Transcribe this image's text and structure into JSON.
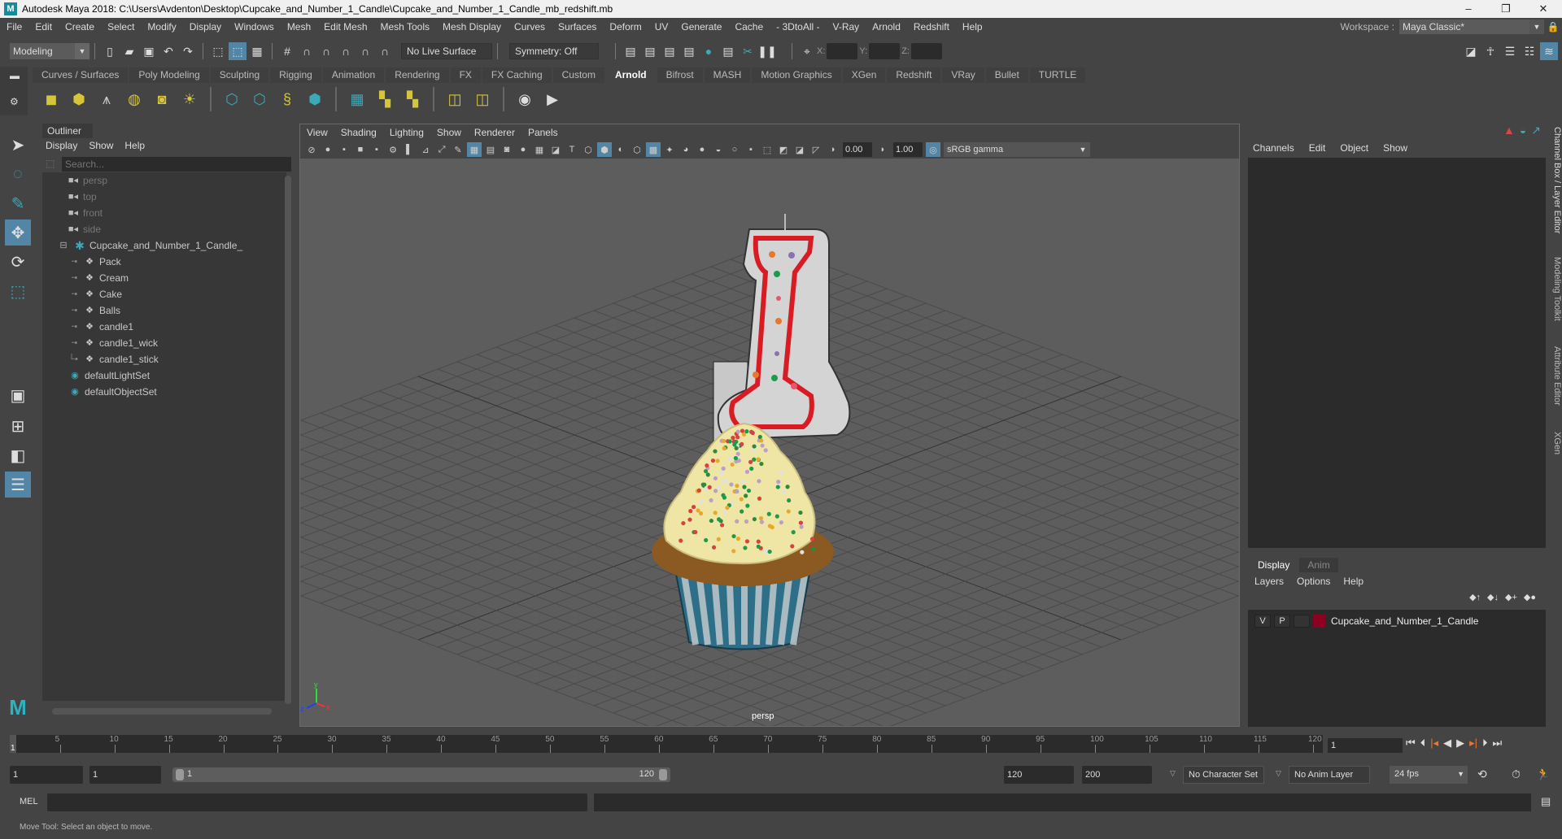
{
  "window": {
    "title": "Autodesk Maya 2018: C:\\Users\\Avdenton\\Desktop\\Cupcake_and_Number_1_Candle\\Cupcake_and_Number_1_Candle_mb_redshift.mb",
    "logo": "M",
    "minimize": "–",
    "maximize": "❐",
    "close": "✕"
  },
  "menubar": {
    "items": [
      "File",
      "Edit",
      "Create",
      "Select",
      "Modify",
      "Display",
      "Windows",
      "Mesh",
      "Edit Mesh",
      "Mesh Tools",
      "Mesh Display",
      "Curves",
      "Surfaces",
      "Deform",
      "UV",
      "Generate",
      "Cache",
      "- 3DtoAll -",
      "V-Ray",
      "Arnold",
      "Redshift",
      "Help"
    ],
    "workspace_label": "Workspace :",
    "workspace_value": "Maya Classic*"
  },
  "statusline": {
    "mode": "Modeling",
    "live_surface": "No Live Surface",
    "symmetry": "Symmetry: Off",
    "x_label": "X:",
    "y_label": "Y:",
    "z_label": "Z:"
  },
  "shelf": {
    "tabs": [
      "Curves / Surfaces",
      "Poly Modeling",
      "Sculpting",
      "Rigging",
      "Animation",
      "Rendering",
      "FX",
      "FX Caching",
      "Custom",
      "Arnold",
      "Bifrost",
      "MASH",
      "Motion Graphics",
      "XGen",
      "Redshift",
      "VRay",
      "Bullet",
      "TURTLE"
    ],
    "active_tab": "Arnold"
  },
  "outliner": {
    "title": "Outliner",
    "menu": [
      "Display",
      "Show",
      "Help"
    ],
    "search_placeholder": "Search...",
    "cameras": [
      "persp",
      "top",
      "front",
      "side"
    ],
    "group": "Cupcake_and_Number_1_Candle_",
    "children": [
      "Pack",
      "Cream",
      "Cake",
      "Balls",
      "candle1",
      "candle1_wick",
      "candle1_stick"
    ],
    "sets": [
      "defaultLightSet",
      "defaultObjectSet"
    ]
  },
  "viewport": {
    "menu": [
      "View",
      "Shading",
      "Lighting",
      "Show",
      "Renderer",
      "Panels"
    ],
    "exposure": "0.00",
    "gamma_value": "1.00",
    "color_space": "sRGB gamma",
    "camera_label": "persp",
    "axis": {
      "x": "x",
      "y": "y",
      "z": "z"
    }
  },
  "channelbox": {
    "menu": [
      "Channels",
      "Edit",
      "Object",
      "Show"
    ],
    "layer_tabs": [
      "Display",
      "Anim"
    ],
    "active_layer_tab": "Display",
    "layer_menu": [
      "Layers",
      "Options",
      "Help"
    ],
    "layer": {
      "v": "V",
      "p": "P",
      "name": "Cupcake_and_Number_1_Candle",
      "color": "#8c0020"
    }
  },
  "side_tabs": [
    "Channel Box / Layer Editor",
    "Modeling Toolkit",
    "Attribute Editor",
    "XGen"
  ],
  "timeline": {
    "ticks": [
      5,
      10,
      15,
      20,
      25,
      30,
      35,
      40,
      45,
      50,
      55,
      60,
      65,
      70,
      75,
      80,
      85,
      90,
      95,
      100,
      105,
      110,
      115,
      120
    ],
    "range_min": 1,
    "range_max": 120,
    "current_frame": "1",
    "current_frame_field": "1"
  },
  "range": {
    "start": "1",
    "start_inner": "1",
    "slider_start": "1",
    "slider_end": "120",
    "end_inner": "120",
    "end": "200",
    "character_set": "No Character Set",
    "anim_layer": "No Anim Layer",
    "fps": "24 fps"
  },
  "cmdline": {
    "label": "MEL"
  },
  "helpline": {
    "text": "Move Tool: Select an object to move."
  }
}
